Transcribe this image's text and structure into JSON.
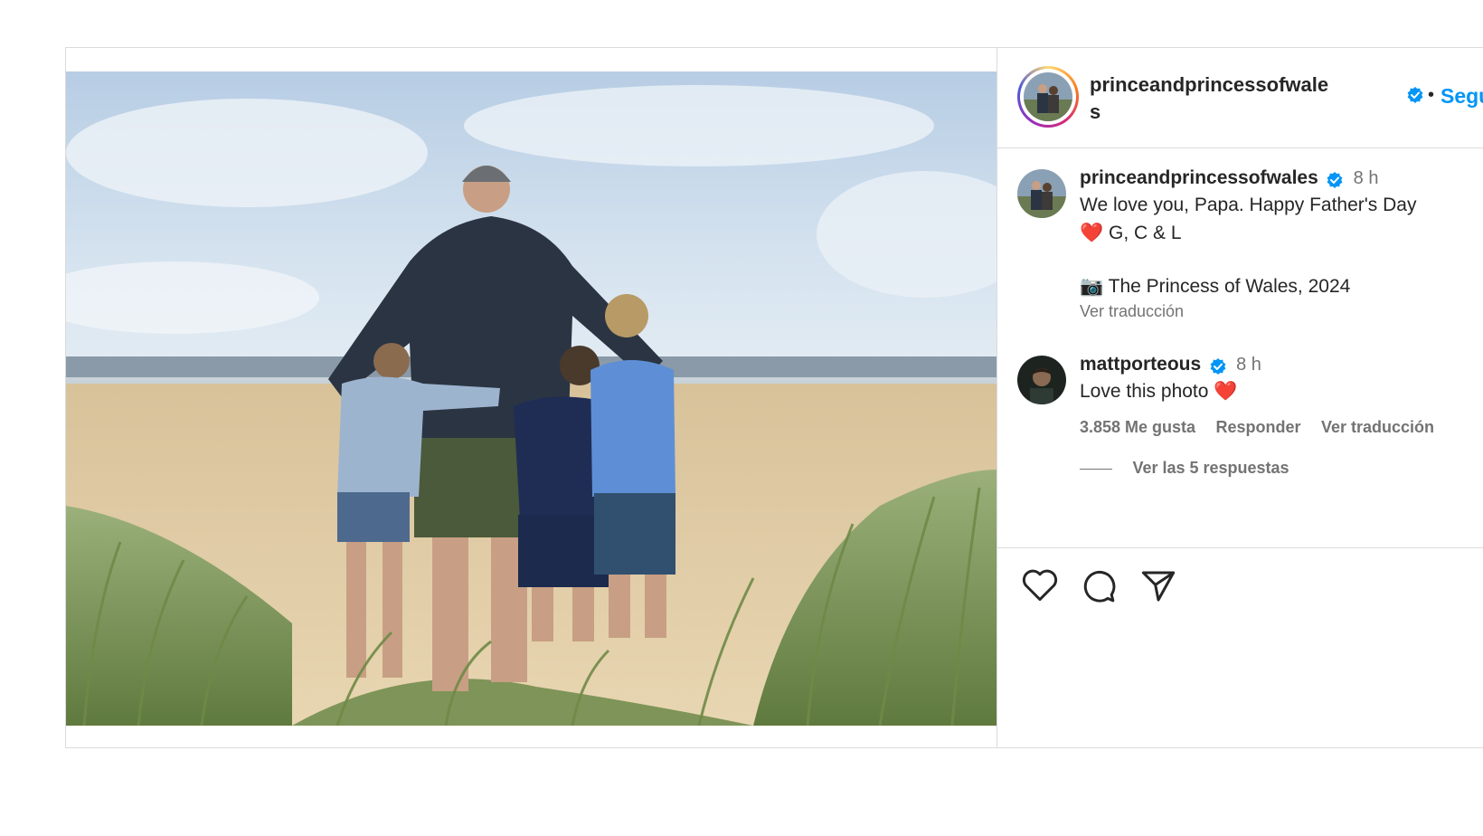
{
  "post": {
    "photo_alt": "",
    "header": {
      "username": "princeandprincessofwales",
      "verified": true,
      "separator": "•",
      "follow_label": "Seguir",
      "more_label": "•••"
    },
    "caption": {
      "username": "princeandprincessofwales",
      "verified": true,
      "time": "8 h",
      "line1": "We love you, Papa. Happy Father's Day",
      "heart": "❤️",
      "line2": "G, C & L",
      "camera": "📷",
      "credit": "The Princess of Wales, 2024",
      "translate_label": "Ver traducción"
    },
    "comment": {
      "username": "mattporteous",
      "verified": true,
      "time": "8 h",
      "text": "Love this photo",
      "heart": "❤️",
      "likes": "3.858 Me gusta",
      "reply_label": "Responder",
      "translate_label": "Ver traducción",
      "view_replies": "Ver las 5 respuestas"
    },
    "actions": {
      "like_icon": "heart-icon",
      "comment_icon": "comment-icon",
      "share_icon": "paper-plane-icon",
      "save_icon": "bookmark-icon",
      "emoji_icon": "smiley-icon"
    },
    "colors": {
      "link_blue": "#0095f6",
      "verified_blue": "#0095f6",
      "text_dark": "#262626",
      "text_muted": "#737373",
      "border": "#dbdbdb"
    }
  }
}
